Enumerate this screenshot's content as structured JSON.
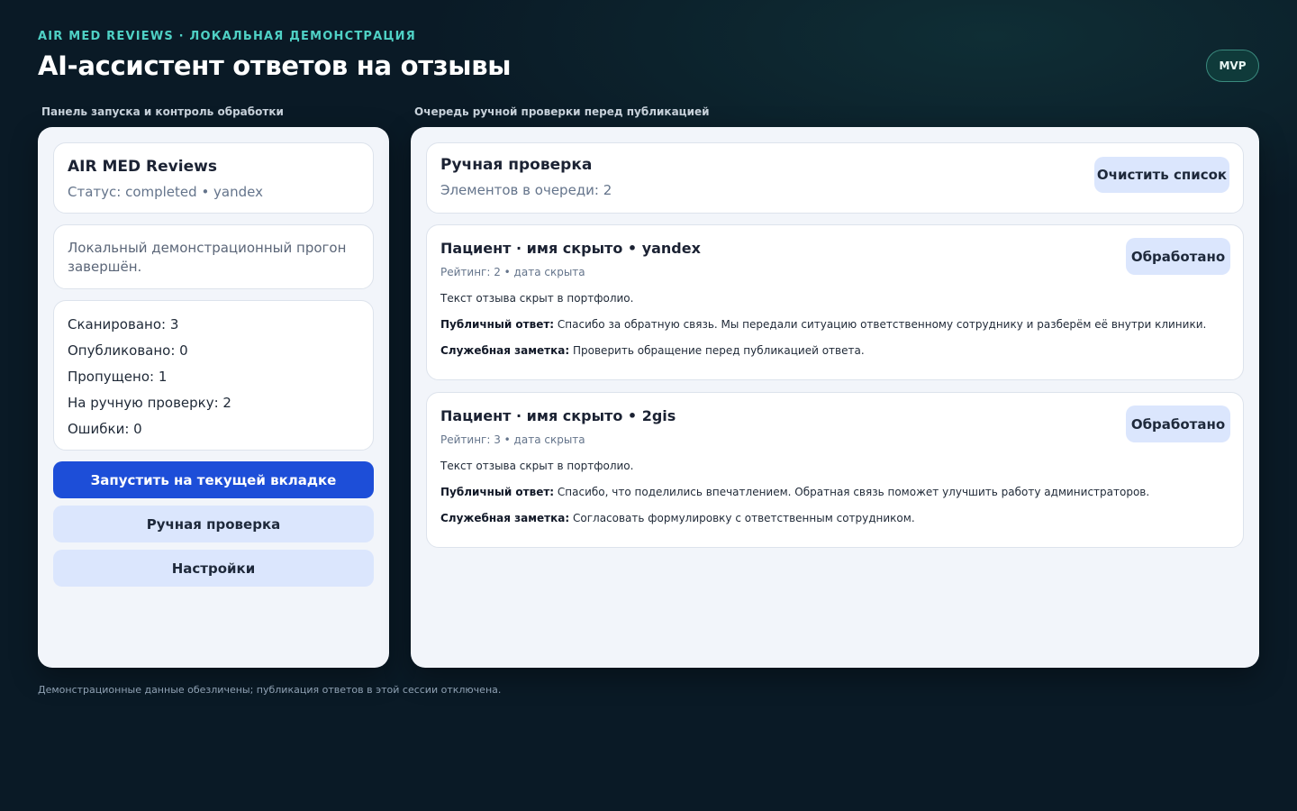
{
  "header": {
    "eyebrow": "AIR MED REVIEWS · ЛОКАЛЬНАЯ ДЕМОНСТРАЦИЯ",
    "title": "AI-ассистент ответов на отзывы",
    "badge": "MVP"
  },
  "left_panel": {
    "caption": "Панель запуска и контроль обработки",
    "app_name": "AIR MED Reviews",
    "status_line": "Статус: completed • yandex",
    "message": "Локальный демонстрационный прогон завершён.",
    "stats": [
      "Сканировано: 3",
      "Опубликовано: 0",
      "Пропущено: 1",
      "На ручную проверку: 2",
      "Ошибки: 0"
    ],
    "run_button": "Запустить на текущей вкладке",
    "review_button": "Ручная проверка",
    "settings_button": "Настройки"
  },
  "right_panel": {
    "caption": "Очередь ручной проверки перед публикацией",
    "title": "Ручная проверка",
    "queue_count": "Элементов в очереди: 2",
    "clear_button": "Очистить список",
    "reviews": [
      {
        "title": "Пациент · имя скрыто • yandex",
        "meta": "Рейтинг: 2 • дата скрыта",
        "text": "Текст отзыва скрыт в портфолио.",
        "public_label": "Публичный ответ:",
        "public_reply": "Спасибо за обратную связь. Мы передали ситуацию ответственному сотруднику и разберём её внутри клиники.",
        "note_label": "Служебная заметка:",
        "note": "Проверить обращение перед публикацией ответа.",
        "done_button": "Обработано"
      },
      {
        "title": "Пациент · имя скрыто • 2gis",
        "meta": "Рейтинг: 3 • дата скрыта",
        "text": "Текст отзыва скрыт в портфолио.",
        "public_label": "Публичный ответ:",
        "public_reply": "Спасибо, что поделились впечатлением. Обратная связь поможет улучшить работу администраторов.",
        "note_label": "Служебная заметка:",
        "note": "Согласовать формулировку с ответственным сотрудником.",
        "done_button": "Обработано"
      }
    ]
  },
  "footer": {
    "note": "Демонстрационные данные обезличены; публикация ответов в этой сессии отключена."
  },
  "colors": {
    "accent": "#4fd1c5",
    "primary_button": "#1d4ed8",
    "secondary_button": "#dbe6fd",
    "background": "#0a1a26"
  }
}
